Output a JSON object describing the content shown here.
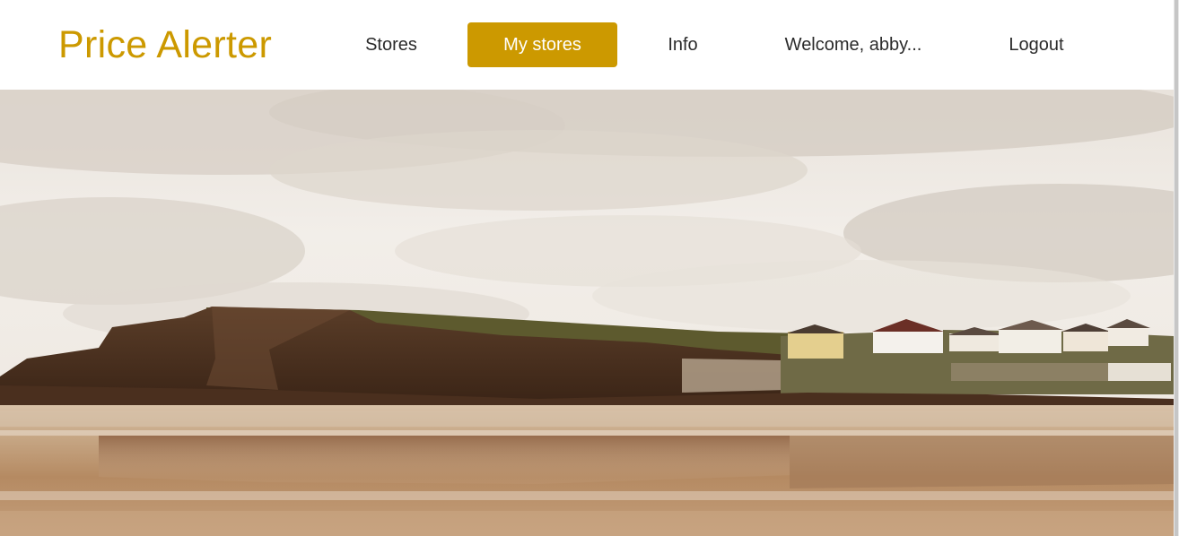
{
  "brand": {
    "title": "Price Alerter",
    "color": "#cc9900"
  },
  "nav": {
    "stores": "Stores",
    "my_stores": "My stores",
    "info": "Info",
    "welcome": "Welcome, abby...",
    "logout": "Logout",
    "active_item": "My stores",
    "active_color": "#cc9900"
  },
  "hero": {
    "image": "beach-cliff-landscape"
  }
}
